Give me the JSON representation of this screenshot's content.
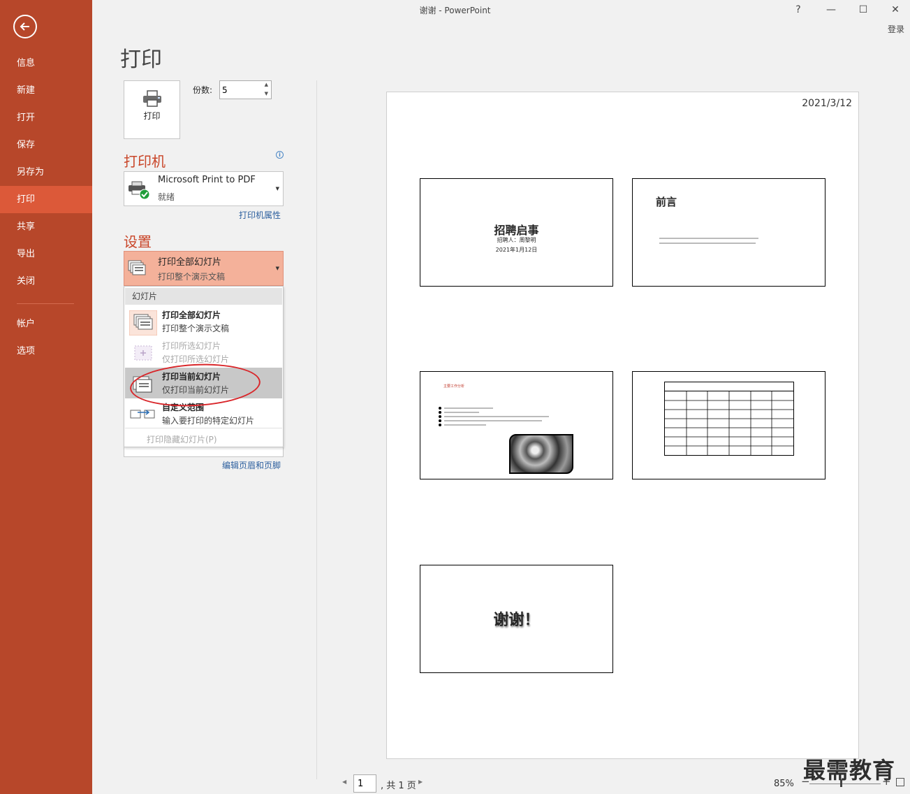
{
  "window": {
    "title": "谢谢 - PowerPoint",
    "help": "?",
    "minimize": "—",
    "maximize": "☐",
    "close": "✕",
    "login": "登录"
  },
  "nav": {
    "items": [
      {
        "label": "信息"
      },
      {
        "label": "新建"
      },
      {
        "label": "打开"
      },
      {
        "label": "保存"
      },
      {
        "label": "另存为"
      },
      {
        "label": "打印"
      },
      {
        "label": "共享"
      },
      {
        "label": "导出"
      },
      {
        "label": "关闭"
      },
      {
        "label": "帐户"
      },
      {
        "label": "选项"
      }
    ],
    "active": "打印"
  },
  "print": {
    "page_title": "打印",
    "print_button": "打印",
    "copies_label": "份数:",
    "copies_value": "5"
  },
  "printer": {
    "heading": "打印机",
    "name": "Microsoft Print to PDF",
    "status": "就绪",
    "properties_link": "打印机属性"
  },
  "settings": {
    "heading": "设置",
    "selected_title": "打印全部幻灯片",
    "selected_sub": "打印整个演示文稿",
    "menu": {
      "header": "幻灯片",
      "items": [
        {
          "title": "打印全部幻灯片",
          "sub": "打印整个演示文稿",
          "disabled": false
        },
        {
          "title": "打印所选幻灯片",
          "sub": "仅打印所选幻灯片",
          "disabled": true
        },
        {
          "title": "打印当前幻灯片",
          "sub": "仅打印当前幻灯片",
          "disabled": false
        },
        {
          "title": "自定义范围",
          "sub": "输入要打印的特定幻灯片",
          "disabled": false
        }
      ],
      "hidden_slides": "打印隐藏幻灯片(P)"
    },
    "header_footer_link": "编辑页眉和页脚"
  },
  "preview": {
    "date": "2021/3/12",
    "slides": [
      {
        "title": "招聘启事",
        "subtitle": "招聘人：周黎明",
        "date": "2021年1月12日"
      },
      {
        "title": "前言"
      },
      {
        "title": "主要工作分析"
      },
      {
        "title": ""
      },
      {
        "title": "谢谢！"
      }
    ]
  },
  "pager": {
    "current": "1",
    "total": ", 共 1 页",
    "prev": "◀",
    "next": "▶"
  },
  "zoom": {
    "percent": "85%",
    "minus": "−",
    "plus": "+"
  },
  "watermark": "最需教育",
  "colors": {
    "nav_bg": "#b7472a",
    "nav_active": "#dc5939",
    "heading": "#c94528",
    "selected_dropdown": "#f4b19a"
  }
}
